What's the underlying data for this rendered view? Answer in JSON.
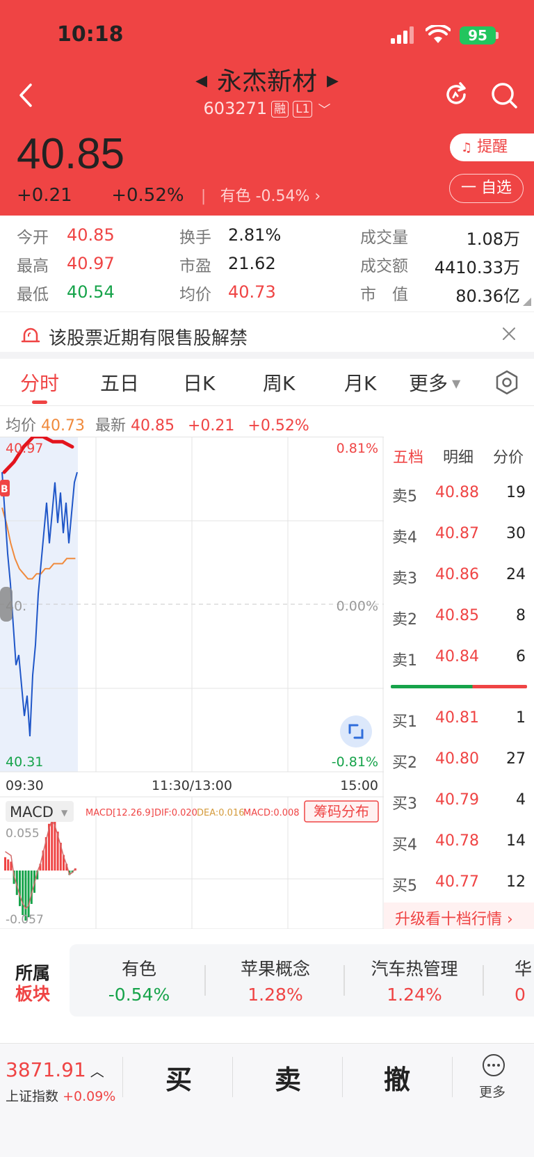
{
  "status_bar": {
    "time": "10:18",
    "battery": "95"
  },
  "header": {
    "stock_name": "永杰新材",
    "stock_code": "603271",
    "tag_margin": "融",
    "tag_level": "L1",
    "price": "40.85",
    "change": "+0.21",
    "change_pct": "+0.52%",
    "sector_name": "有色",
    "sector_change": "-0.54%",
    "alert_label": "提醒",
    "watchlist_label": "一 自选"
  },
  "quote": {
    "open_label": "今开",
    "open": "40.85",
    "high_label": "最高",
    "high": "40.97",
    "low_label": "最低",
    "low": "40.54",
    "turnover_label": "换手",
    "turnover": "2.81%",
    "pe_label": "市盈",
    "pe": "21.62",
    "avg_label": "均价",
    "avg": "40.73",
    "volume_label": "成交量",
    "volume": "1.08万",
    "amount_label": "成交额",
    "amount": "4410.33万",
    "mktcap_label": "市　值",
    "mktcap": "80.36亿"
  },
  "notice": {
    "text": "该股票近期有限售股解禁"
  },
  "tabs": [
    "分时",
    "五日",
    "日K",
    "周K",
    "月K",
    "更多"
  ],
  "chart_info": {
    "avg_label": "均价",
    "avg_value": "40.73",
    "latest_label": "最新",
    "latest_value": "40.85",
    "change": "+0.21",
    "change_pct": "+0.52%"
  },
  "chart_data": {
    "type": "line",
    "y_top_label": "40.97",
    "y_mid_label": "40.",
    "y_bottom_label": "40.31",
    "pct_top": "0.81%",
    "pct_mid": "0.00%",
    "pct_bottom": "-0.81%",
    "x_labels": [
      "09:30",
      "11:30/13:00",
      "15:00"
    ],
    "ylim": [
      40.31,
      40.97
    ],
    "price_series": [
      40.9,
      40.82,
      40.74,
      40.68,
      40.6,
      40.52,
      40.54,
      40.48,
      40.42,
      40.46,
      40.38,
      40.5,
      40.56,
      40.66,
      40.72,
      40.78,
      40.84,
      40.76,
      40.82,
      40.88,
      40.8,
      40.86,
      40.78,
      40.84,
      40.76,
      40.82,
      40.88,
      40.9
    ],
    "avg_series": [
      40.83,
      40.8,
      40.76,
      40.73,
      40.71,
      40.7,
      40.69,
      40.69,
      40.7,
      40.7,
      40.71,
      40.71,
      40.72,
      40.72,
      40.72,
      40.73,
      40.73,
      40.73
    ],
    "chip_series": [
      40.9,
      40.92,
      40.95,
      40.97,
      40.97,
      40.96,
      40.96,
      40.95
    ]
  },
  "macd": {
    "label": "MACD",
    "params": "MACD[12.26.9]",
    "dif": "DIF:0.020",
    "dea": "DEA:0.016",
    "macd": "MACD:0.008",
    "chip_button": "筹码分布",
    "top_value": "0.055",
    "bottom_value": "-0.057",
    "bars": [
      0.012,
      0.01,
      0.008,
      -0.012,
      -0.022,
      -0.032,
      -0.04,
      -0.045,
      -0.042,
      -0.03,
      -0.02,
      -0.008,
      0.006,
      0.018,
      0.03,
      0.042,
      0.05,
      0.045,
      0.035,
      0.025,
      0.014,
      0.006,
      -0.004,
      -0.002,
      0.002
    ]
  },
  "order_book": {
    "tabs": [
      "五档",
      "明细",
      "分价"
    ],
    "asks": [
      {
        "label": "卖5",
        "price": "40.88",
        "vol": "19"
      },
      {
        "label": "卖4",
        "price": "40.87",
        "vol": "30"
      },
      {
        "label": "卖3",
        "price": "40.86",
        "vol": "24"
      },
      {
        "label": "卖2",
        "price": "40.85",
        "vol": "8"
      },
      {
        "label": "卖1",
        "price": "40.84",
        "vol": "6"
      }
    ],
    "bids": [
      {
        "label": "买1",
        "price": "40.81",
        "vol": "1"
      },
      {
        "label": "买2",
        "price": "40.80",
        "vol": "27"
      },
      {
        "label": "买3",
        "price": "40.79",
        "vol": "4"
      },
      {
        "label": "买4",
        "price": "40.78",
        "vol": "14"
      },
      {
        "label": "买5",
        "price": "40.77",
        "vol": "12"
      }
    ],
    "upgrade_label": "升级看十档行情 ›"
  },
  "sectors": {
    "title_line1": "所属",
    "title_line2": "板块",
    "items": [
      {
        "name": "有色",
        "change": "-0.54%"
      },
      {
        "name": "苹果概念",
        "change": "1.28%"
      },
      {
        "name": "汽车热管理",
        "change": "1.24%"
      },
      {
        "name": "华",
        "change": "0"
      }
    ]
  },
  "footer": {
    "index_value": "3871.91",
    "index_name": "上证指数",
    "index_change": "+0.09%",
    "buy": "买",
    "sell": "卖",
    "cancel": "撤",
    "more": "更多"
  },
  "colors": {
    "accent": "#ef4444",
    "up": "#ef4444",
    "down": "#16a34a",
    "avg": "#f08a3c",
    "price": "#1f56c8"
  }
}
